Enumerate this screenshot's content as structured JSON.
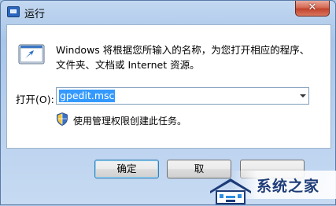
{
  "window": {
    "title": "运行",
    "close_label": "✕"
  },
  "dialog": {
    "description_line1": "Windows 将根据您所输入的名称，为您打开相应的程序、",
    "description_line2": "文件夹、文档或 Internet 资源。",
    "open_label": "打开(O):",
    "open_value": "gpedit.msc",
    "admin_note": "使用管理权限创建此任务。"
  },
  "buttons": {
    "ok_label": "确定",
    "cancel_label": "取",
    "browse_label": "浏览"
  },
  "watermark": {
    "text": "系统之家",
    "color": "#1d3c78"
  },
  "icons": {
    "app": "run-dialog-icon",
    "shield": "uac-shield-icon",
    "dropdown": "chevron-down-icon"
  },
  "colors": {
    "selection": "#3399ff",
    "close_button": "#c2432c",
    "frame": "#a9c6e6"
  }
}
